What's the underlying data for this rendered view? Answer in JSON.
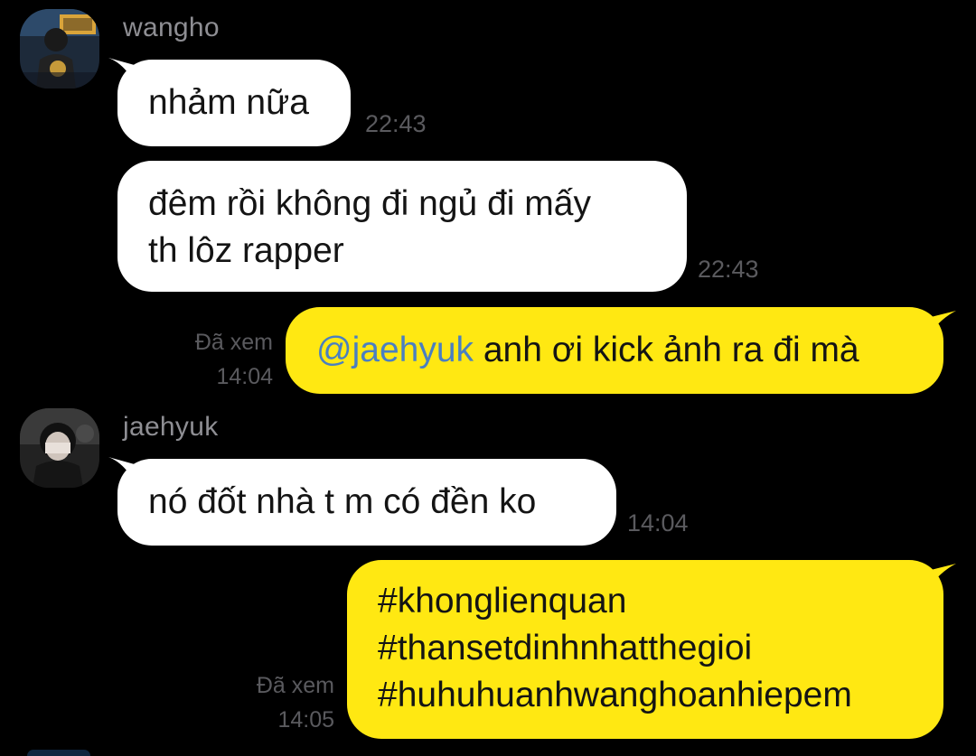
{
  "messages": [
    {
      "sender": "wangho",
      "bubbles": [
        {
          "lines": [
            "nhảm nữa"
          ],
          "time": "22:43"
        },
        {
          "lines": [
            "đêm rồi không đi ngủ đi mấy",
            "th lôz rapper"
          ],
          "time": "22:43"
        }
      ]
    },
    {
      "sender": "me",
      "bubbles": [
        {
          "mention": "@jaehyuk",
          "text": " anh ơi kick ảnh ra đi mà",
          "status": "Đã xem",
          "time": "14:04"
        }
      ]
    },
    {
      "sender": "jaehyuk",
      "bubbles": [
        {
          "lines": [
            "nó đốt nhà t m có đền ko"
          ],
          "time": "14:04"
        }
      ]
    },
    {
      "sender": "me",
      "bubbles": [
        {
          "lines": [
            "#khonglienquan",
            "#thansetdinhnhatthegioi",
            "#huhuhuanhwanghoanhiepem"
          ],
          "status": "Đã xem",
          "time": "14:05"
        }
      ]
    }
  ],
  "colors": {
    "background": "#000000",
    "incoming_bubble": "#ffffff",
    "outgoing_bubble": "#ffe812",
    "mention": "#4a7fc1",
    "meta_text": "#5a5a5e",
    "sender_name": "#8e8e93"
  },
  "icons": {
    "avatar_wangho": "avatar-photo-icon",
    "avatar_jaehyuk": "avatar-photo-icon"
  }
}
